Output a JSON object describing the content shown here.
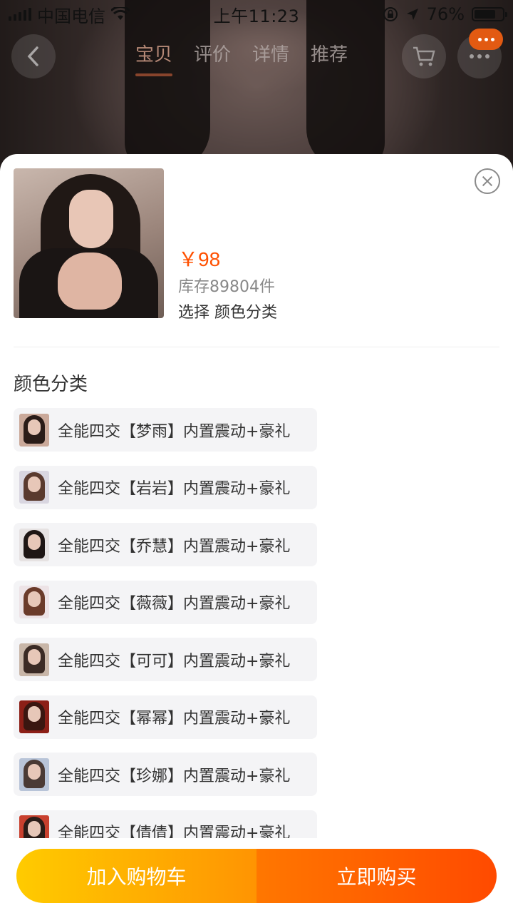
{
  "status_bar": {
    "carrier": "中国电信",
    "time": "上午11:23",
    "battery_percent": "76%",
    "battery_level": 0.76,
    "icons": [
      "signal-icon",
      "wifi-icon",
      "rotation-lock-icon",
      "location-icon",
      "battery-icon"
    ]
  },
  "nav": {
    "tabs": [
      {
        "label": "宝贝",
        "active": true
      },
      {
        "label": "评价",
        "active": false
      },
      {
        "label": "详情",
        "active": false
      },
      {
        "label": "推荐",
        "active": false
      }
    ],
    "icons": [
      "back-arrow-icon",
      "cart-icon",
      "more-icon"
    ]
  },
  "sheet": {
    "price": "￥98",
    "stock": "库存89804件",
    "selected": "选择  颜色分类",
    "section_title": "颜色分类",
    "options": [
      {
        "label": "全能四交【梦雨】内置震动+豪礼",
        "hair": "#2a1c18",
        "bg": "#caa99a"
      },
      {
        "label": "全能四交【岩岩】内置震动+豪礼",
        "hair": "#5a3a2e",
        "bg": "#d9d6e0"
      },
      {
        "label": "全能四交【乔慧】内置震动+豪礼",
        "hair": "#1e1614",
        "bg": "#e6e2e2"
      },
      {
        "label": "全能四交【薇薇】内置震动+豪礼",
        "hair": "#6b3b2a",
        "bg": "#ede3e6"
      },
      {
        "label": "全能四交【可可】内置震动+豪礼",
        "hair": "#3b2b25",
        "bg": "#c8b6a8"
      },
      {
        "label": "全能四交【幂幂】内置震动+豪礼",
        "hair": "#3a1610",
        "bg": "#8c1f17"
      },
      {
        "label": "全能四交【珍娜】内置震动+豪礼",
        "hair": "#4a3a35",
        "bg": "#b8c4d8"
      },
      {
        "label": "全能四交【倩倩】内置震动+豪礼",
        "hair": "#2a1c18",
        "bg": "#c8402e"
      }
    ]
  },
  "actions": {
    "add_to_cart": "加入购物车",
    "buy_now": "立即购买"
  },
  "colors": {
    "price": "#ff5000",
    "cart_button": "#ffb400",
    "buy_button": "#ff5f00"
  }
}
